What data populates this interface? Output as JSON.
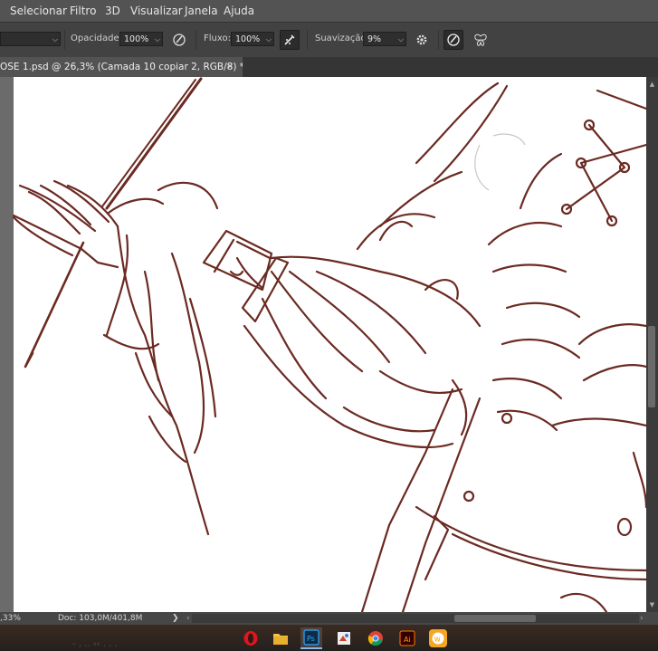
{
  "menu": {
    "items": [
      "Selecionar",
      "Filtro",
      "3D",
      "Visualizar",
      "Janela",
      "Ajuda"
    ]
  },
  "options": {
    "opacity_label": "Opacidade:",
    "opacity_value": "100%",
    "flow_label": "Fluxo:",
    "flow_value": "100%",
    "smoothing_label": "Suavização:",
    "smoothing_value": "9%"
  },
  "document_tab": {
    "title": "OSE 1.psd @ 26,3% (Camada 10 copiar 2, RGB/8) *",
    "close": "×"
  },
  "status": {
    "zoom": ",33%",
    "doc_size": "Doc: 103,0M/401,8M",
    "more": "❯"
  },
  "taskbar": {
    "ghost_text": "- , .. ‹‹ . . .",
    "apps": [
      "opera-icon",
      "file-explorer-icon",
      "photoshop-icon",
      "paint-app-icon",
      "chrome-icon",
      "illustrator-icon",
      "w-app-icon"
    ]
  },
  "colors": {
    "line_art": "#6b2a22",
    "canvas": "#ffffff",
    "ui_background": "#535353",
    "options_bar": "#424242"
  }
}
